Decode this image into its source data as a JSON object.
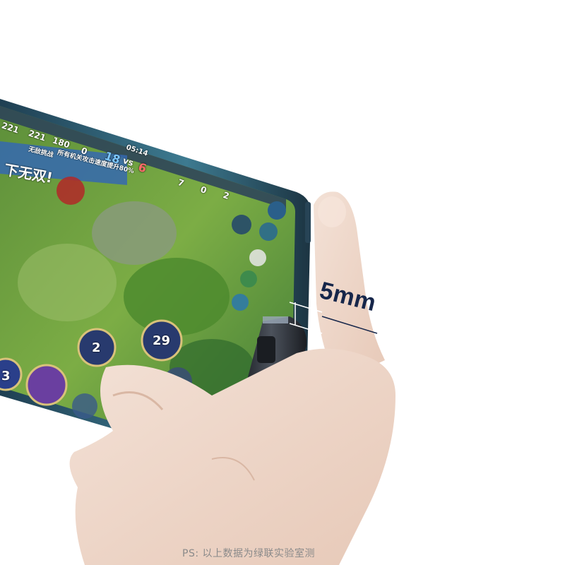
{
  "measurement_label": "5mm",
  "footnote": "PS: 以上数据为绿联实验室测",
  "game_hud": {
    "stat_a": "221",
    "stat_b": "221",
    "stat_c": "180",
    "stat_d": "0",
    "score_left": "18",
    "vs": "vs",
    "score_right": "6",
    "time": "05:14",
    "banner_title": "无敌挑战",
    "banner_text": "所有机关攻击速度提升80%",
    "big_text": "下无双!",
    "kills": "7",
    "deaths": "0",
    "assists": "2",
    "skill_level_1": "2",
    "skill_level_2": "29",
    "skill_level_3": "3"
  },
  "colors": {
    "phone_frame": "#2c5a6e",
    "cable": "#2a2d33",
    "label": "#16264a"
  }
}
